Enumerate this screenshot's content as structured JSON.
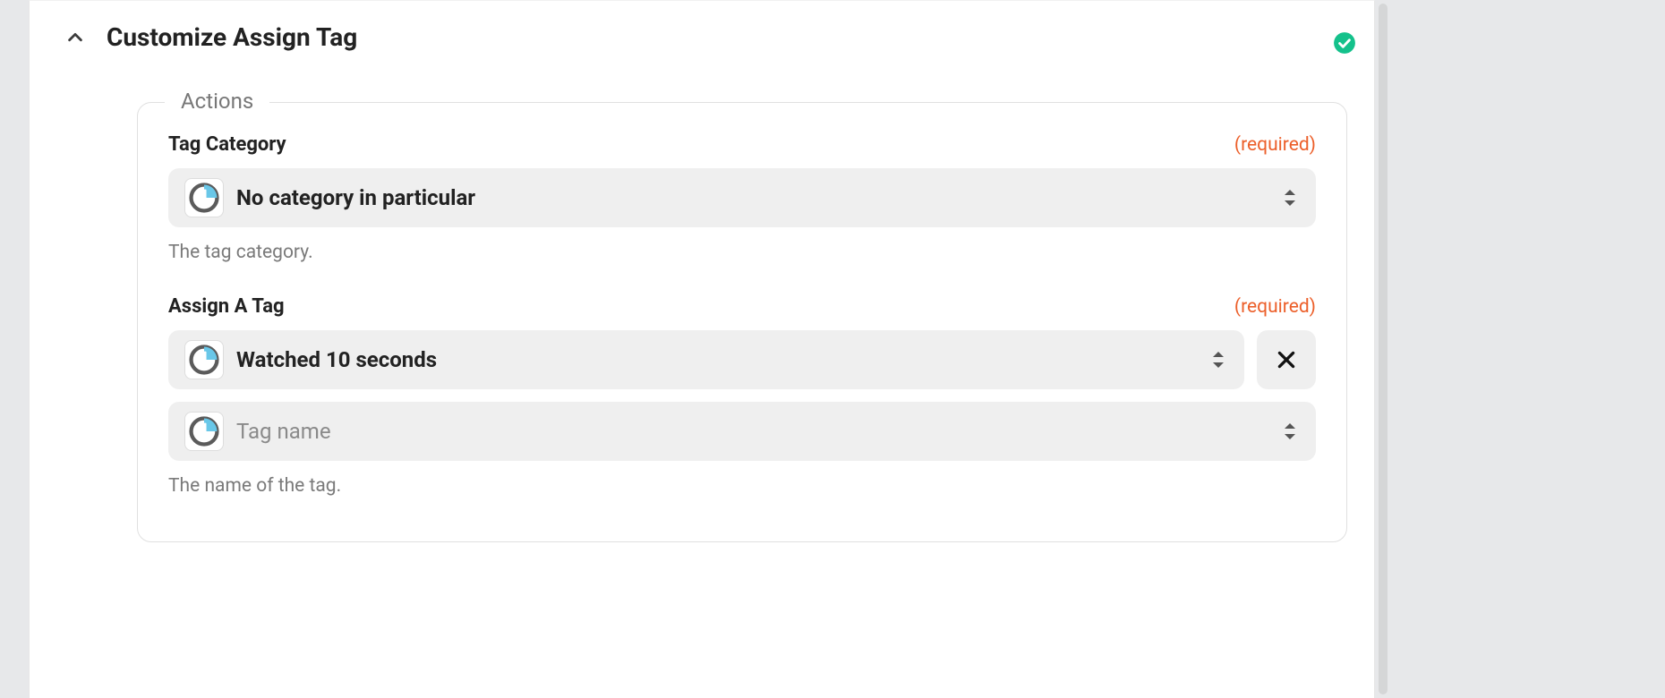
{
  "header": {
    "title": "Customize Assign Tag"
  },
  "fieldset": {
    "legend": "Actions"
  },
  "fields": {
    "tagCategory": {
      "label": "Tag Category",
      "required_text": "(required)",
      "value": "No category in particular",
      "helper": "The tag category."
    },
    "assignTag": {
      "label": "Assign A Tag",
      "required_text": "(required)",
      "rows": [
        {
          "value": "Watched 10 seconds",
          "clearable": true
        },
        {
          "placeholder": "Tag name"
        }
      ],
      "helper": "The name of the tag."
    }
  }
}
